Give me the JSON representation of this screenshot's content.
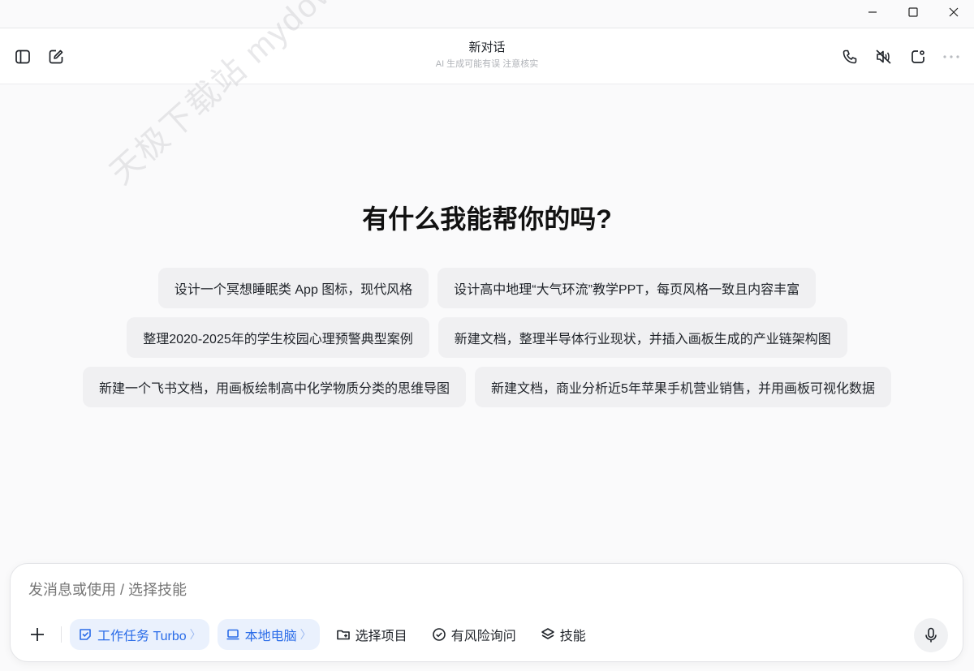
{
  "header": {
    "title": "新对话",
    "subtitle": "AI 生成可能有误 注意核实"
  },
  "watermark": "天极下载站 mydown.yesky.com",
  "main": {
    "greeting": "有什么我能帮你的吗?",
    "suggestions": [
      [
        "设计一个冥想睡眠类 App 图标，现代风格",
        "设计高中地理“大气环流”教学PPT，每页风格一致且内容丰富"
      ],
      [
        "整理2020-2025年的学生校园心理预警典型案例",
        "新建文档，整理半导体行业现状，并插入画板生成的产业链架构图"
      ],
      [
        "新建一个飞书文档，用画板绘制高中化学物质分类的思维导图",
        "新建文档，商业分析近5年苹果手机营业销售，并用画板可视化数据"
      ]
    ]
  },
  "composer": {
    "placeholder": "发消息或使用 / 选择技能",
    "task_mode": "工作任务 Turbo",
    "local_computer": "本地电脑",
    "select_project": "选择项目",
    "risk_ask": "有风险询问",
    "skills": "技能"
  },
  "colors": {
    "accent": "#2a6ce8",
    "accent_bg": "#eaf1fd",
    "chip_bg": "#f0f0f2"
  },
  "icons": [
    "minimize-icon",
    "maximize-icon",
    "close-icon",
    "sidebar-toggle-icon",
    "new-chat-icon",
    "phone-icon",
    "mute-icon",
    "new-window-icon",
    "more-icon",
    "plus-icon",
    "task-icon",
    "laptop-icon",
    "folder-icon",
    "shield-check-icon",
    "skills-icon",
    "microphone-icon"
  ]
}
